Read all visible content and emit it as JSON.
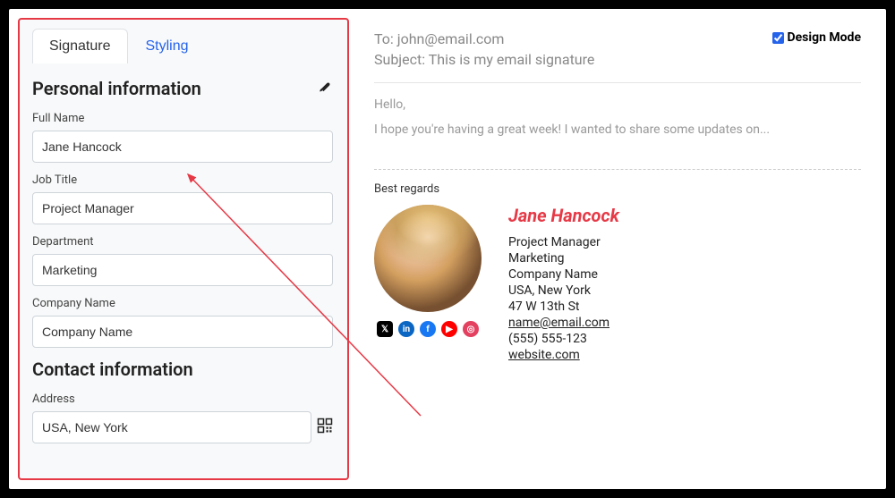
{
  "tabs": {
    "signature": "Signature",
    "styling": "Styling"
  },
  "sections": {
    "personal": "Personal information",
    "contact": "Contact information"
  },
  "fields": {
    "full_name": {
      "label": "Full Name",
      "value": "Jane Hancock"
    },
    "job_title": {
      "label": "Job Title",
      "value": "Project Manager"
    },
    "department": {
      "label": "Department",
      "value": "Marketing"
    },
    "company": {
      "label": "Company Name",
      "value": "Company Name"
    },
    "address": {
      "label": "Address",
      "value": "USA, New York"
    }
  },
  "preview": {
    "to": "To: john@email.com",
    "subject": "Subject: This is my email signature",
    "design_mode_label": "Design Mode",
    "design_mode_checked": true,
    "greeting": "Hello,",
    "body": "I hope you're having a great week! I wanted to share some updates on...",
    "regards": "Best regards"
  },
  "signature": {
    "name": "Jane Hancock",
    "title": "Project Manager",
    "department": "Marketing",
    "company": "Company Name",
    "location": "USA, New York",
    "street": "47 W 13th St",
    "email": "name@email.com",
    "phone": "(555) 555-123",
    "website": "website.com"
  },
  "icons": {
    "brush": "brush-icon",
    "qr": "qr-icon"
  },
  "social": [
    "x",
    "linkedin",
    "facebook",
    "youtube",
    "instagram"
  ],
  "colors": {
    "accent": "#e63946",
    "link": "#2563eb"
  }
}
